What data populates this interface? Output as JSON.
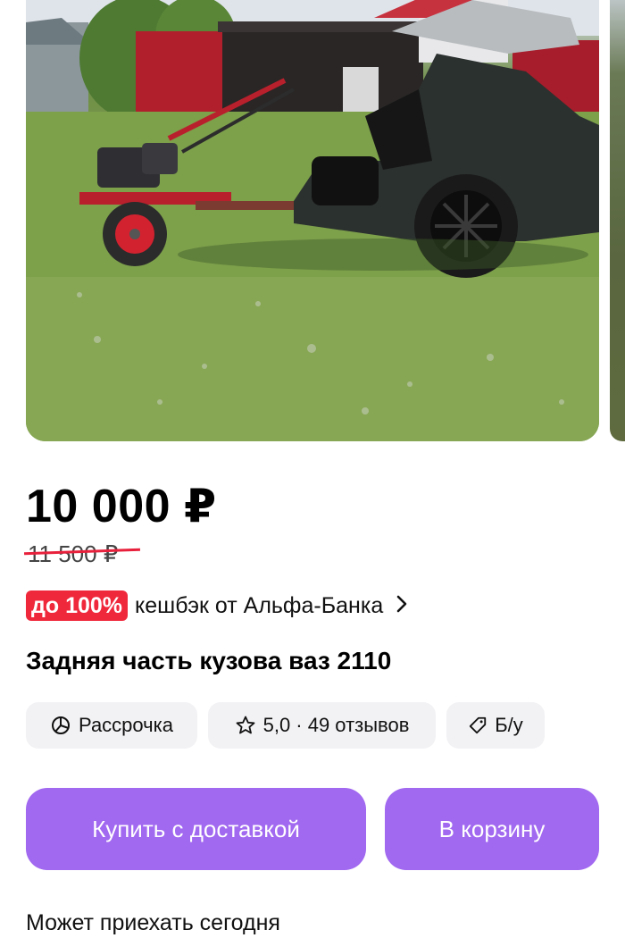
{
  "product": {
    "price": "10 000 ₽",
    "old_price": "11 500 ₽",
    "title": "Задняя часть кузова ваз 2110"
  },
  "cashback": {
    "badge": "до 100%",
    "text": "кешбэк от Альфа-Банка",
    "icon": "chevron-right-icon"
  },
  "chips": [
    {
      "label": "Рассрочка",
      "icon": "pie-chart-icon"
    },
    {
      "label": "5,0 · 49 отзывов",
      "icon": "star-icon"
    },
    {
      "label": "Б/у",
      "icon": "tag-icon"
    }
  ],
  "actions": {
    "buy_label": "Купить с доставкой",
    "cart_label": "В корзину"
  },
  "delivery_note": "Может приехать сегодня",
  "colors": {
    "accent": "#a168f0",
    "cashback_badge": "#f0283c",
    "old_price_strike": "#e8203b"
  }
}
